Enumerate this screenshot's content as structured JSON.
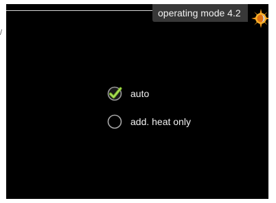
{
  "header": {
    "title": "operating mode 4.2",
    "icon": "sun-icon"
  },
  "options": [
    {
      "label": "auto",
      "selected": true,
      "icon": "checkmark-icon"
    },
    {
      "label": "add. heat only",
      "selected": false,
      "icon": "radio-empty-icon"
    }
  ],
  "colors": {
    "background": "#000000",
    "text": "#f2f2f2",
    "tab": "#383838",
    "check": "#7fbf2a"
  }
}
